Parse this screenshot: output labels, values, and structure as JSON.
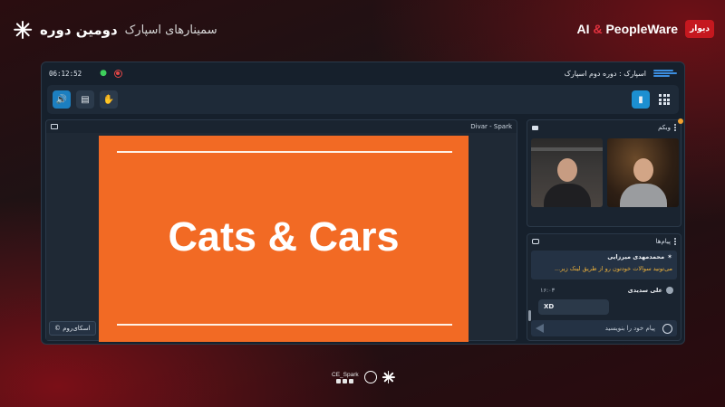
{
  "banner": {
    "left_bold": "دومین دوره",
    "left_light": "سمینارهای اسپارک",
    "right_title_ai": "AI",
    "right_title_amp": "&",
    "right_title_rest": "PeopleWare",
    "badge": "دیوار"
  },
  "topbar": {
    "clock": "06:12:52",
    "room_title": "اسپارک : دوره دوم اسپارک"
  },
  "presentation": {
    "name": "Divar - Spark",
    "slide_title": "Cats & Cars",
    "skyroom_badge": "اسکای‌روم ©"
  },
  "webcam": {
    "label": "وبکم"
  },
  "chat": {
    "label": "پیام‌ها",
    "pinned_author": "محمدمهدی میرزایی",
    "pinned_message": "می‌تونید سوالات خودتون رو از طریق لینک زیر...",
    "message_author": "علی سدیدی",
    "message_time": "۱۶:۰۳",
    "message_text": "XD",
    "input_placeholder": "پیام خود را بنویسید"
  },
  "footer": {
    "handle": "CE_Spark"
  },
  "colors": {
    "slide_bg": "#f26a24",
    "accent_blue": "#1c7fc0",
    "pinned_text": "#f2b43a",
    "record_red": "#e24646",
    "wifi_green": "#3ecf5c"
  },
  "icons": {
    "toolbar_left": [
      "speaker-icon",
      "folder-icon",
      "hand-raise-icon"
    ],
    "toolbar_right": [
      "chat-icon",
      "grid-icon"
    ]
  }
}
